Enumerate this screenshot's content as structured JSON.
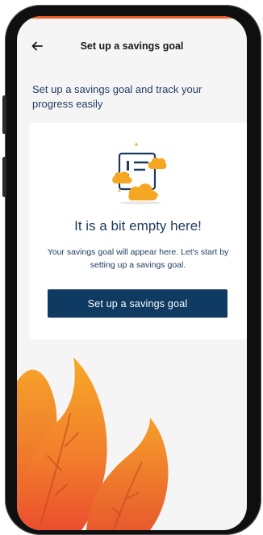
{
  "header": {
    "title": "Set up a savings goal",
    "back_icon": "arrow-left-icon"
  },
  "intro": {
    "text": "Set up a savings goal and track your progress easily"
  },
  "empty_state": {
    "illustration": "empty-board-clouds-illustration",
    "title": "It is a bit empty here!",
    "description": "Your savings goal will appear here. Let's start by setting up a savings goal.",
    "cta_label": "Set up a savings goal"
  },
  "colors": {
    "primary": "#0f3a61",
    "text": "#1f3a5f",
    "accent": "#f2612d",
    "cloud": "#f5a623",
    "background": "#f5f5f5"
  }
}
